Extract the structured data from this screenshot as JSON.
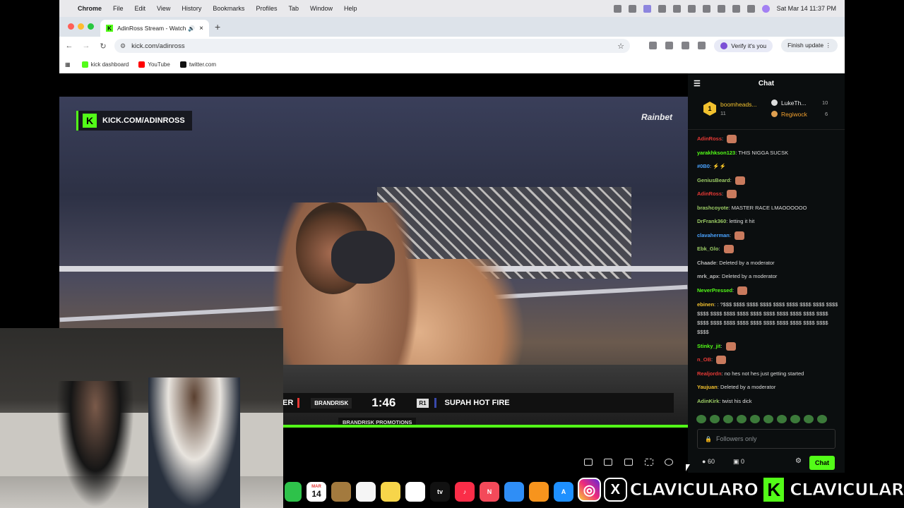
{
  "menubar": {
    "app": "Chrome",
    "items": [
      "File",
      "Edit",
      "View",
      "History",
      "Bookmarks",
      "Profiles",
      "Tab",
      "Window",
      "Help"
    ],
    "clock": "Sat Mar 14  11:37 PM"
  },
  "browser": {
    "tab_title": "AdinRoss Stream - Watch",
    "url": "kick.com/adinross",
    "verify_label": "Verify it's you",
    "finish_label": "Finish update",
    "bookmarks": [
      {
        "label": "kick dashboard",
        "color": "#53fc18"
      },
      {
        "label": "YouTube",
        "color": "#ff0000"
      },
      {
        "label": "twitter.com",
        "color": "#111111"
      }
    ]
  },
  "video": {
    "kick_badge": "KICK.COM/ADINROSS",
    "sponsor": "Rainbet",
    "fighter_left": "ER",
    "promotion_logo": "BRANDRISK",
    "clock": "1:46",
    "round": "R1",
    "fighter_right": "SUPAH HOT FIRE",
    "promotion": "BRANDRISK PROMOTIONS"
  },
  "chat": {
    "title": "Chat",
    "pinned": {
      "top_user": "boomheads...",
      "top_count": "11",
      "rank": "1",
      "user2": "LukeTh...",
      "count2": "10",
      "user3": "Regiwock",
      "count3": "6"
    },
    "messages": [
      {
        "user": "AdinRoss",
        "text": "",
        "color": "#e53935"
      },
      {
        "user": "yarakhkson123",
        "text": "THIS NIGGA SUCSK",
        "color": "#53fc18"
      },
      {
        "user": "#0B0",
        "text": "⚡⚡",
        "color": "#4aa3ff"
      },
      {
        "user": "GeniusBeard",
        "text": "",
        "color": "#9ccc65"
      },
      {
        "user": "AdinRoss",
        "text": "",
        "color": "#e53935"
      },
      {
        "user": "brashcoyote",
        "text": "MASTER RACE LMAOOOOOO",
        "color": "#9ccc65"
      },
      {
        "user": "DrFrank360",
        "text": "letting it hit",
        "color": "#9ccc65"
      },
      {
        "user": "clavaherman",
        "text": "",
        "color": "#4aa3ff"
      },
      {
        "user": "Ebk_Glo",
        "text": "",
        "color": "#9ccc65"
      },
      {
        "user": "Chaade",
        "text": "Deleted by a moderator",
        "color": "#bbbbbb"
      },
      {
        "user": "mrk_apx",
        "text": "Deleted by a moderator",
        "color": "#bbbbbb"
      },
      {
        "user": "NeverPressed",
        "text": "",
        "color": "#53fc18"
      },
      {
        "user": "ebinen",
        "text": ": ?$$$ $$$$ $$$$ $$$$ $$$$ $$$$ $$$$ $$$$ $$$$ $$$$ $$$$ $$$$ $$$$ $$$$ $$$$ $$$$ $$$$ $$$$ $$$$ $$$$ $$$$ $$$$ $$$$ $$$$ $$$$ $$$$ $$$$ $$$$ $$$$ $$$$",
        "color": "#f2c12e"
      },
      {
        "user": "Stinky_jit",
        "text": "",
        "color": "#53fc18"
      },
      {
        "user": "n_OB",
        "text": "",
        "color": "#e53935"
      },
      {
        "user": "Realjordn",
        "text": "no hes not hes just getting started",
        "color": "#e53935"
      },
      {
        "user": "Yaujuan",
        "text": "Deleted by a moderator",
        "color": "#f2c12e"
      },
      {
        "user": "AdinKirk",
        "text": "twist his dick",
        "color": "#9ccc65"
      }
    ],
    "input_placeholder": "Followers only",
    "points": "60",
    "gifts": "0",
    "send_label": "Chat"
  },
  "dock": {
    "calendar_month": "MAR",
    "calendar_day": "14"
  },
  "overlay": {
    "name1": "CLAVICULARO",
    "name2": "CLAVICULAR"
  },
  "colors": {
    "kick_green": "#53fc18",
    "chat_bg": "#0b0e0f"
  }
}
